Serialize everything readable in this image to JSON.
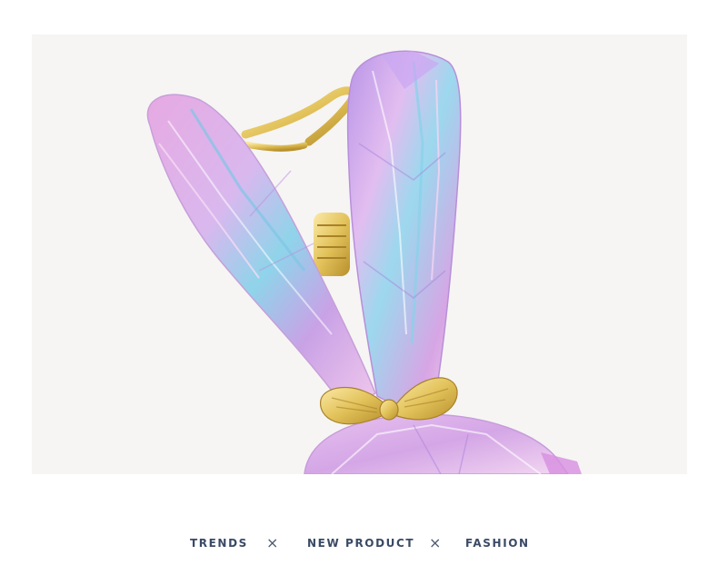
{
  "product_image": {
    "subject": "bunny-ear crystal hair claw clip"
  },
  "tagline": {
    "items": [
      "TRENDS",
      "NEW PRODUCT",
      "FASHION"
    ],
    "separator": "×"
  },
  "colors": {
    "text": "#3a4a66",
    "photo_background": "#f6f5f4",
    "crystal_pink": "#e6b6e4",
    "crystal_blue": "#8fd4e8",
    "gold": "#e2c25a"
  }
}
